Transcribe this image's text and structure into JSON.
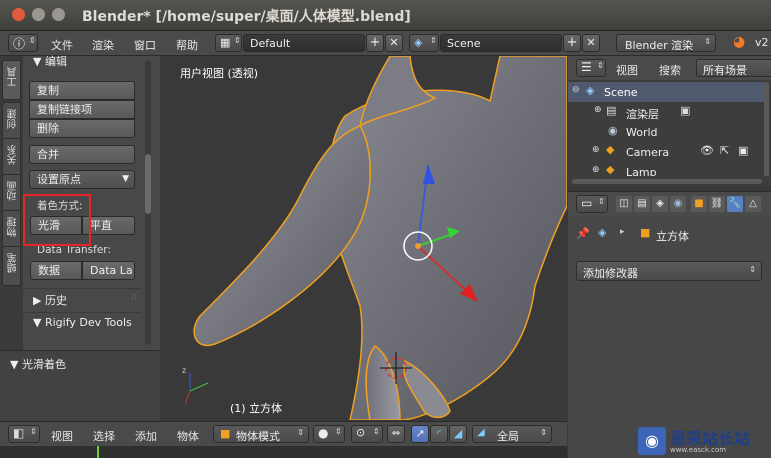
{
  "window": {
    "title": "Blender* [/home/super/桌面/人体模型.blend]"
  },
  "topbar": {
    "menus": [
      "文件",
      "渲染",
      "窗口",
      "帮助"
    ],
    "layout": "Default",
    "scene": "Scene",
    "engine": "Blender 渲染",
    "version": "v2"
  },
  "toolshelf": {
    "tabs": [
      "工具",
      "创建",
      "关系",
      "动画",
      "物理",
      "蜡笔"
    ],
    "section_edit": "编辑",
    "buttons": {
      "duplicate": "复制",
      "duplicate_linked": "复制链接项",
      "delete": "删除",
      "join": "合并",
      "set_origin": "设置原点"
    },
    "shading_label": "着色方式:",
    "shading": {
      "smooth": "光滑",
      "flat": "平直"
    },
    "data_transfer_label": "Data Transfer:",
    "data_transfer": {
      "data": "数据",
      "layout": "Data La"
    },
    "history": "历史",
    "rigify": "Rigify Dev Tools",
    "smooth_shading": "光滑着色"
  },
  "viewport": {
    "view_label": "用户视图 (透视)",
    "object_label": "(1) 立方体"
  },
  "viewport_header": {
    "menus": [
      "视图",
      "选择",
      "添加",
      "物体"
    ],
    "mode": "物体模式",
    "pivot": "全局"
  },
  "outliner": {
    "menus": [
      "视图",
      "搜索"
    ],
    "filter": "所有场景",
    "items": [
      "Scene",
      "渲染层",
      "World",
      "Camera",
      "Lamp"
    ]
  },
  "properties": {
    "breadcrumb": "立方体",
    "add_modifier": "添加修改器"
  },
  "watermark": {
    "text": "易采站长站",
    "url": "www.easck.com"
  },
  "colors": {
    "accent": "#5680c2",
    "selection": "#f09a24",
    "highlight": "#e8262a"
  }
}
